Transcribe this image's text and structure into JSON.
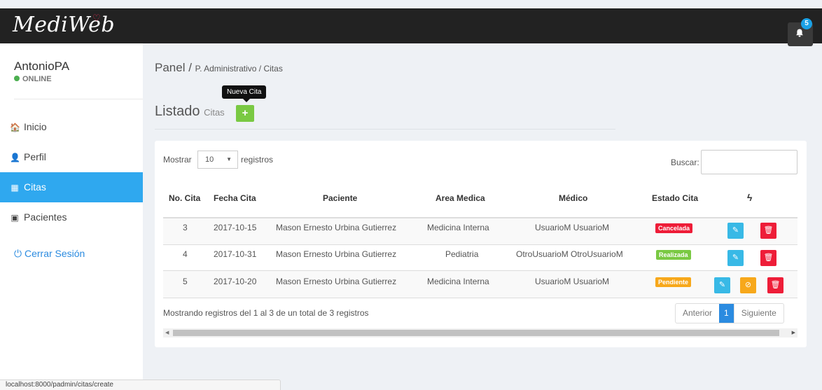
{
  "header": {
    "logo": "MediWeb",
    "logo_accent": "♡",
    "notification_count": "5",
    "colors": {
      "topbar": "#222222",
      "accent": "#2fa8ef",
      "badge": "#1aa1e6"
    }
  },
  "sidebar": {
    "user": "AntonioPA",
    "status": "ONLINE",
    "items": [
      {
        "label": "Inicio",
        "icon": "home-icon",
        "glyph": "🏠"
      },
      {
        "label": "Perfil",
        "icon": "user-icon",
        "glyph": "👤"
      },
      {
        "label": "Citas",
        "icon": "calendar-icon",
        "glyph": "▦",
        "active": true
      },
      {
        "label": "Pacientes",
        "icon": "id-card-icon",
        "glyph": "▣"
      }
    ],
    "logout": "Cerrar Sesión",
    "logout_glyph": "⏻"
  },
  "breadcrumb": {
    "main": "Panel",
    "sep": " / ",
    "path": "P. Administrativo / Citas"
  },
  "page": {
    "title": "Listado",
    "subtitle": "Citas",
    "add_button": "+",
    "add_tooltip": "Nueva Cita"
  },
  "table_controls": {
    "show_label": "Mostrar",
    "page_size": "10",
    "records_label": "registros",
    "search_label": "Buscar:",
    "search_value": ""
  },
  "table": {
    "columns": [
      "No. Cita",
      "Fecha Cita",
      "Paciente",
      "Area Medica",
      "Médico",
      "Estado Cita"
    ],
    "actions_icon": "bolt-icon",
    "actions_glyph": "ϟ",
    "rows": [
      {
        "no": "3",
        "date": "2017-10-15",
        "patient": "Mason Ernesto Urbina Gutierrez",
        "area": "Medicina Interna",
        "doctor": "UsuarioM UsuarioM",
        "status": "Cancelada",
        "status_color": "#ee1d38"
      },
      {
        "no": "4",
        "date": "2017-10-31",
        "patient": "Mason Ernesto Urbina Gutierrez",
        "area": "Pediatria",
        "doctor": "OtroUsuarioM OtroUsuarioM",
        "status": "Realizada",
        "status_color": "#7ac943"
      },
      {
        "no": "5",
        "date": "2017-10-20",
        "patient": "Mason Ernesto Urbina Gutierrez",
        "area": "Medicina Interna",
        "doctor": "UsuarioM UsuarioM",
        "status": "Pendiente",
        "status_color": "#f7a81b"
      }
    ],
    "edit_glyph": "✎",
    "delete_glyph": "🗑",
    "cancel_glyph": "⊘"
  },
  "footer": {
    "info": "Mostrando registros del 1 al 3 de un total de 3 registros",
    "prev": "Anterior",
    "current_page": "1",
    "next": "Siguiente"
  },
  "statusbar": {
    "url": "localhost:8000/padmin/citas/create"
  }
}
